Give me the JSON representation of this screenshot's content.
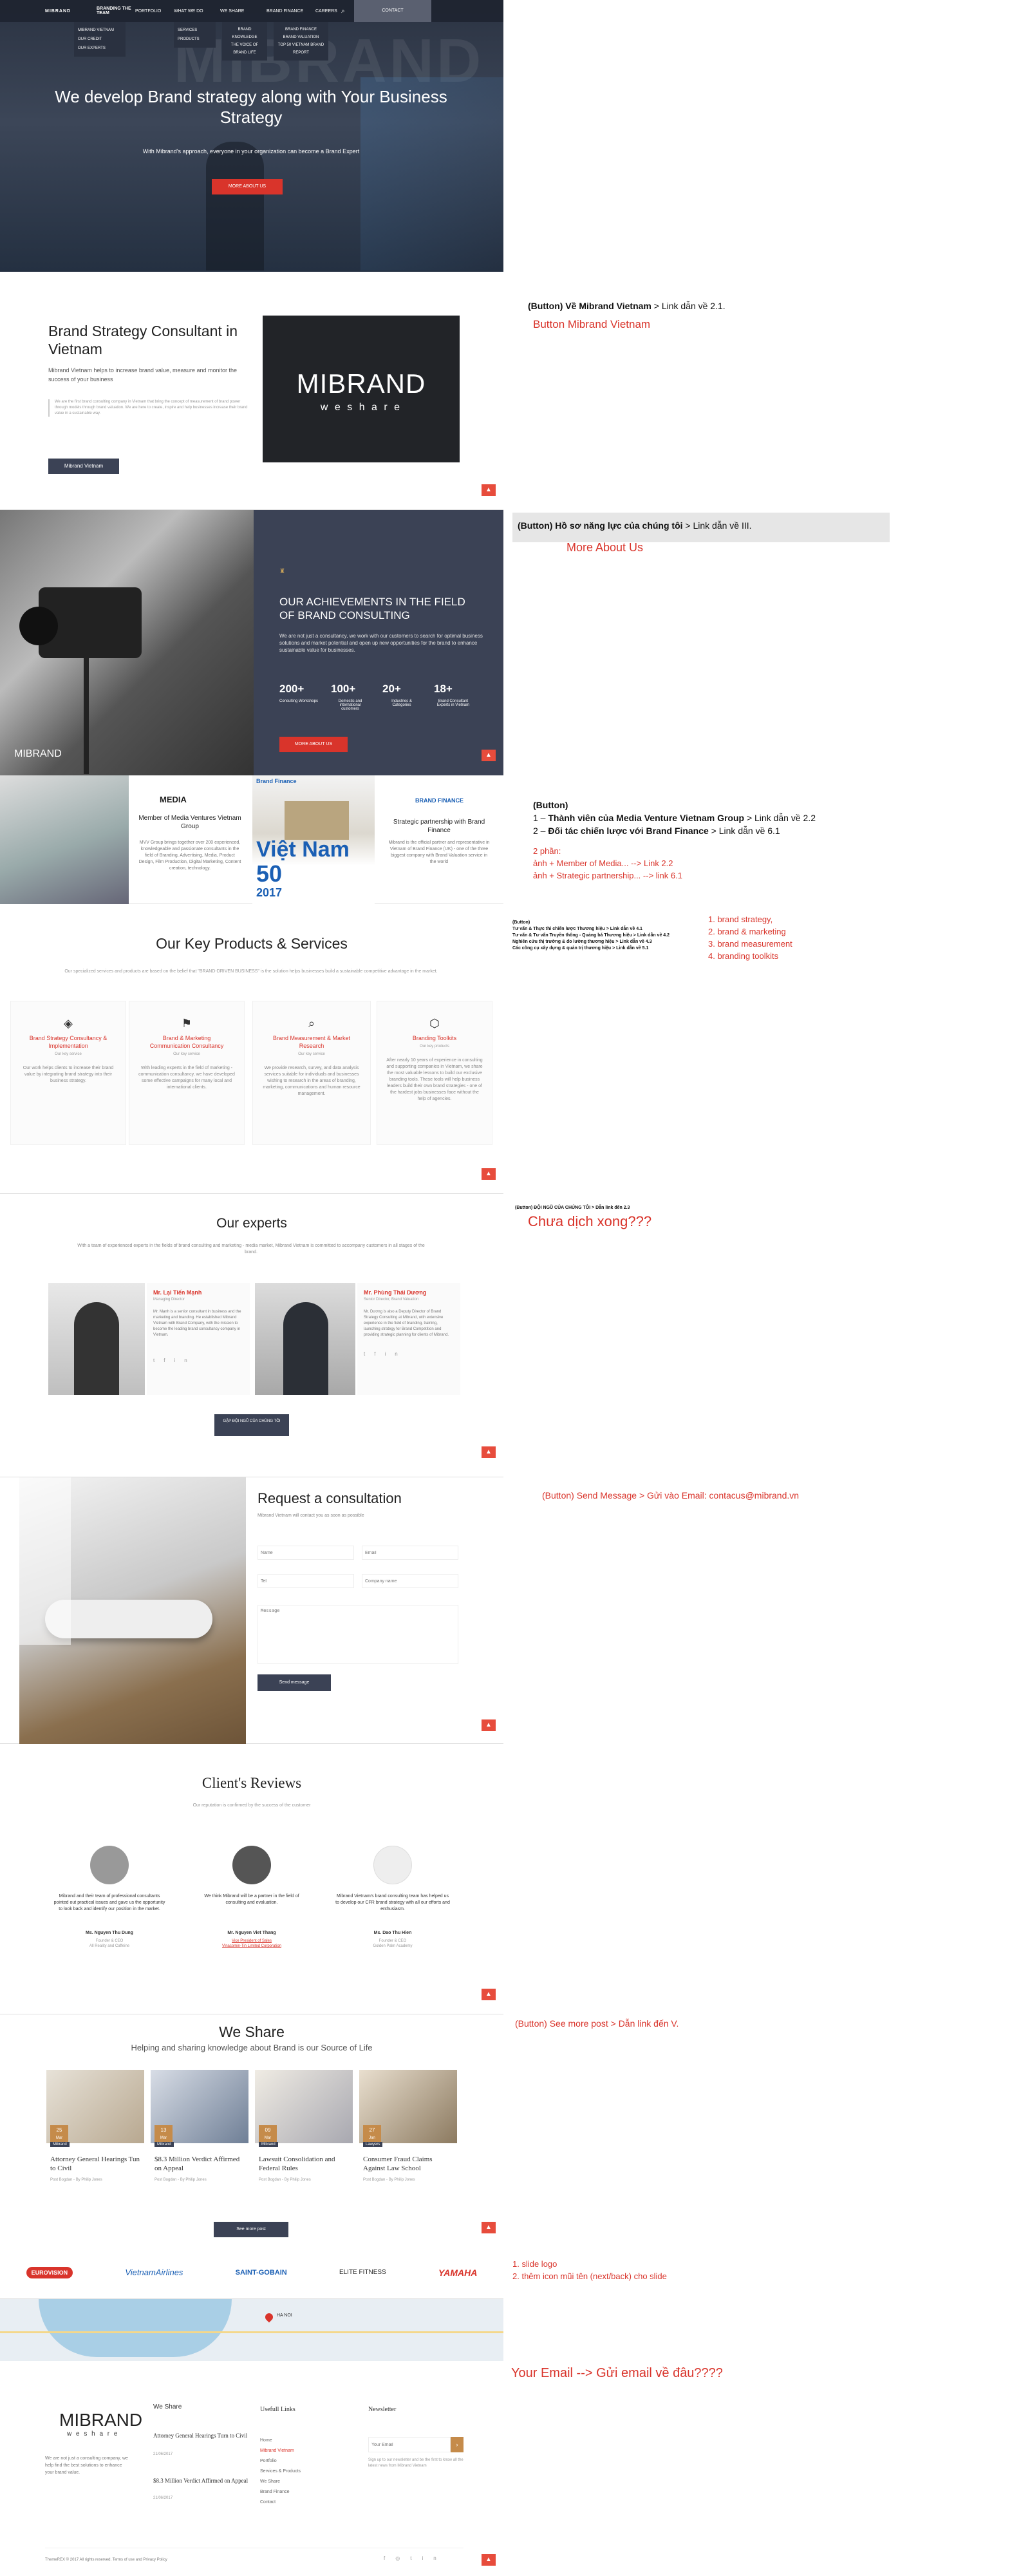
{
  "nav": {
    "logo": "MIBRAND",
    "items": [
      "BRANDING THE TEAM",
      "PORTFOLIO",
      "WHAT WE DO",
      "WE SHARE",
      "BRAND FINANCE",
      "CAREERS"
    ],
    "contact": "CONTACT",
    "drop1": [
      "MIBRAND VIETNAM",
      "OUR CREDIT",
      "OUR EXPERTS"
    ],
    "drop2": [
      "SERVICES",
      "PRODUCTS"
    ],
    "drop3": [
      "BRAND KNOWLEDGE",
      "THE VOICE OF BRAND LIFE"
    ],
    "drop4": [
      "BRAND FINANCE",
      "BRAND VALUATION",
      "TOP 50 VIETNAM BRAND REPORT"
    ]
  },
  "hero": {
    "title": "We develop Brand strategy along with Your Business Strategy",
    "subtitle": "With Mibrand's approach, everyone in your organization can become a Brand Expert",
    "button": "MORE ABOUT US",
    "bg_text": "MIBRAND"
  },
  "consultant": {
    "title": "Brand Strategy Consultant in Vietnam",
    "lead": "Mibrand Vietnam helps to increase brand value, measure and monitor the success of your business",
    "quote": "We are the first brand consulting company in Vietnam that bring the concept of measurement of brand power through models through brand valuation. We are here to create, inspire and help businesses increase their brand value in a sustainable way.",
    "button": "Mibrand Vietnam",
    "logo_main": "MIBRAND",
    "logo_sub": "w e s h a r e"
  },
  "achievements": {
    "title": "OUR ACHIEVEMENTS IN THE FIELD OF BRAND CONSULTING",
    "text": "We are not just a consultancy, we work with our customers to search for optimal business solutions and market potential and open up new opportunities for the brand to enhance sustainable value for businesses.",
    "stats": [
      {
        "value": "200+",
        "label": "Consulting Workshops"
      },
      {
        "value": "100+",
        "label": "Domestic and international customers"
      },
      {
        "value": "20+",
        "label": "Industries & Categories"
      },
      {
        "value": "18+",
        "label": "Brand Consultant Experts in Vietnam"
      }
    ],
    "button": "MORE ABOUT US",
    "logo": "MIBRAND"
  },
  "partners": {
    "media_logo": "MEDIA",
    "media_title": "Member of Media Ventures Vietnam Group",
    "media_text": "MVV Group brings together over 200 experienced, knowledgeable and passionate consultants in the field of Branding, Advertising, Media, Product Design, Film Production, Digital Marketing, Content creation, technology.",
    "bf_label": "Brand Finance",
    "vn_title": "Việt Nam",
    "vn_number": "50",
    "vn_year": "2017",
    "bf_logo": "BRAND FINANCE",
    "bf_title": "Strategic partnership with Brand Finance",
    "bf_text": "Mibrand is the official partner and representative in Vietnam of Brand Finance (UK) - one of the three biggest company with Brand Valuation service in the world"
  },
  "products": {
    "title": "Our Key Products & Services",
    "intro": "Our specialized services and products are based on the belief that \"BRAND-DRIVEN BUSINESS\" is the solution helps businesses build a sustainable competitive advantage in the market.",
    "items": [
      {
        "title": "Brand Strategy Consultancy & Implementation",
        "sub": "Our key service",
        "text": "Our work helps clients to increase their brand value by integrating brand strategy into their business strategy."
      },
      {
        "title": "Brand & Marketing Communication Consultancy",
        "sub": "Our key service",
        "text": "With leading experts in the field of marketing - communication consultancy, we have developed some effective campaigns for many local and international clients."
      },
      {
        "title": "Brand Measurement & Market Research",
        "sub": "Our key service",
        "text": "We provide research, survey, and data analysis services suitable for individuals and businesses wishing to research in the areas of branding, marketing, communications and human resource management."
      },
      {
        "title": "Branding Toolkits",
        "sub": "Our key products",
        "text": "After nearly 10 years of experience in consulting and supporting companies in Vietnam, we share the most valuable lessons to build our exclusive branding tools. These tools will help business leaders build their own brand strategies - one of the hardest jobs businesses face without the help of agencies."
      }
    ]
  },
  "experts": {
    "title": "Our experts",
    "intro": "With a team of experienced experts in the fields of brand consulting and marketing - media market, Mibrand Vietnam is committed to accompany customers in all stages of the brand.",
    "people": [
      {
        "name": "Mr. Lại Tiến Mạnh",
        "role": "Managing Director",
        "bio": "Mr. Mạnh is a senior consultant in business and the marketing and branding. He established Mibrand Vietnam with Brand Company, with the mission to become the leading brand consultancy company in Vietnam."
      },
      {
        "name": "Mr. Phùng Thái Dương",
        "role": "Senior Director, Brand Valuation",
        "bio": "Mr. Dương is also a Deputy Director of Brand Strategy Consulting at Mibrand, with extensive experience in the field of branding, training, launching strategy for Brand Competition and providing strategic planning for clients of Mibrand."
      }
    ],
    "button": "GẶP ĐỘI NGŨ CỦA CHÚNG TÔI"
  },
  "consult": {
    "title": "Request a consultation",
    "sub": "Mibrand Vietnam will contact you as soon as possible",
    "fields": {
      "name": "Name",
      "email": "Email",
      "tel": "Tel",
      "company": "Company name",
      "message": "Message"
    },
    "button": "Send message"
  },
  "reviews": {
    "title": "Client's Reviews",
    "sub": "Our reputation is confirmed by the success of the customer",
    "items": [
      {
        "text": "Mibrand and their team of professional consultants pointed out practical issues and gave us the opportunity to look back and identify our position in the market.",
        "name": "Ms. Nguyen Thu Dung",
        "org": "Founder & CEO",
        "org2": "All Reality and Caffeine"
      },
      {
        "text": "We think Mibrand will be a partner in the field of consulting and evaluation.",
        "name": "Mr. Nguyen Viet Thang",
        "org": "Vice President of Sales",
        "org2": "Vinacomin-Tin Limited Corporation"
      },
      {
        "text": "Mibrand Vietnam's brand consulting team has helped us to develop our CFR brand strategy with all our efforts and enthusiasm.",
        "name": "Ms. Dao Thu Hien",
        "org": "Founder & CEO",
        "org2": "Golden Palm Academy"
      }
    ]
  },
  "share": {
    "title": "We Share",
    "sub": "Helping and sharing knowledge about Brand is our Source of Life",
    "posts": [
      {
        "day": "25",
        "month": "Mar",
        "cat": "Mibrand",
        "title": "Attorney General Hearings Tun to Civil",
        "meta": "Post Bogdan - By Philip Jones"
      },
      {
        "day": "13",
        "month": "Mar",
        "cat": "Mibrand",
        "title": "$8.3 Million Verdict Affirmed on Appeal",
        "meta": "Post Bogdan - By Philip Jones"
      },
      {
        "day": "09",
        "month": "Mar",
        "cat": "Mibrand",
        "title": "Lawsuit Consolidation and Federal Rules",
        "meta": "Post Bogdan - By Philip Jones"
      },
      {
        "day": "27",
        "month": "Jan",
        "cat": "Lawyers",
        "title": "Consumer Fraud Claims Against Law School",
        "meta": "Post Bogdan - By Philip Jones"
      }
    ],
    "button": "See more post"
  },
  "logos": [
    "EUROVISION",
    "VietnamAirlines",
    "SAINT-GOBAIN",
    "ELITE FITNESS",
    "YAMAHA"
  ],
  "footer": {
    "logo": "MIBRAND",
    "logo_sub": "w e s h a r e",
    "about": "We are not just a consulting company, we help find the best solutions to enhance your brand value.",
    "share_title": "We Share",
    "share_items": [
      {
        "title": "Attorney General Hearings Turn to Civil",
        "date": "21/06/2017"
      },
      {
        "title": "$8.3 Million Verdict Affirmed on Appeal",
        "date": "21/06/2017"
      }
    ],
    "links_title": "Usefull Links",
    "links": [
      "Home",
      "Mibrand Vietnam",
      "Portfolio",
      "Services & Products",
      "We Share",
      "Brand Finance",
      "Contact"
    ],
    "news_title": "Newsletter",
    "news_placeholder": "Your Email",
    "news_note": "Sign up to our newsletter and be the first to know all the latest news from Mibrand Vietnam",
    "copyright": "ThemeREX © 2017 All rights reserved. Terms of use and Privacy Policy"
  },
  "map": {
    "label": "HA NOI"
  },
  "annotations": {
    "a1": "(Button) Về Mibrand Vietnam",
    "a1b": " > Link dẫn về 2.1.",
    "a1c": "Button Mibrand Vietnam",
    "a2": "(Button) Hồ sơ năng lực của chúng tôi",
    "a2b": " > Link dẫn về III.",
    "a2c": "More About Us",
    "a3": "(Button)",
    "a3l1a": "1 – ",
    "a3l1b": "Thành viên của Media Venture Vietnam Group",
    "a3l1c": " > Link dẫn về 2.2",
    "a3l2a": "2 – ",
    "a3l2b": "Đối tác chiến lược với Brand Finance",
    "a3l2c": " > Link dẫn về 6.1",
    "a3r1": "2 phần:",
    "a3r2": "ảnh + Member of Media... --> Link 2.2",
    "a3r3": "ảnh + Strategic partnership... --> link 6.1",
    "a4title": "(Button)",
    "a4items": [
      "Tư vấn & Thực thi chiến lược Thương hiệu > Link dẫn về 4.1",
      "Tư vấn & Tư vấn Truyền thông - Quảng bá Thương hiệu > Link dẫn về 4.2",
      "Nghiên cứu thị trường & đo lường thương hiệu > Link dẫn về 4.3",
      "Các công cụ xây dựng & quản trị thương hiệu > Link dẫn về 5.1"
    ],
    "a4red": [
      "1. brand strategy,",
      "2. brand & marketing",
      "3. brand measurement",
      "4. branding toolkits"
    ],
    "a5": "(Button) ĐỘI NGŨ CỦA CHÚNG TÔI > Dẫn link đến 2.3",
    "a5red": "Chưa dịch xong???",
    "a6": "(Button) Send Message > Gửi vào Email: contacus@mibrand.vn",
    "a7": "(Button) See more post > Dẫn link đến V.",
    "a8": [
      "1. slide logo",
      "2. thêm icon mũi tên (next/back) cho slide"
    ],
    "a9": "Your Email --> Gửi email về đâu????"
  },
  "colors": {
    "accent": "#d9342b",
    "navy": "#3b4255",
    "blue": "#1a5fb4"
  }
}
